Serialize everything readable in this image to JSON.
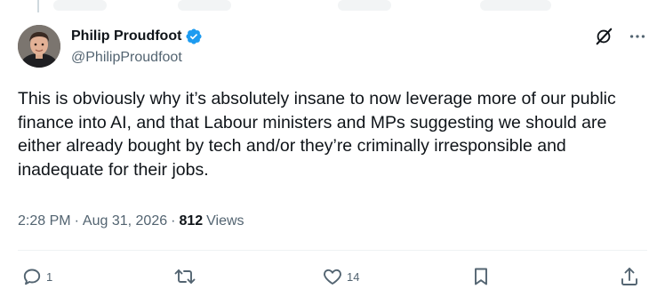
{
  "author": {
    "display_name": "Philip Proudfoot",
    "handle": "@PhilipProudfoot",
    "verified": true
  },
  "tweet": {
    "text": "This is obviously why it’s absolutely insane to now leverage more of our public finance into AI, and that Labour ministers and MPs suggesting we should are either already bought by tech and/or they’re criminally irresponsible and inadequate for their jobs.",
    "time": "2:28 PM",
    "date": "Aug 31, 2026",
    "views_count": "812",
    "views_label": "Views"
  },
  "engagement": {
    "replies": "1",
    "reposts": "",
    "likes": "14"
  },
  "colors": {
    "text_primary": "#0f1419",
    "text_secondary": "#536471",
    "verified_blue": "#1d9bf0",
    "divider": "#eff3f4"
  },
  "icons": [
    "verified-badge-icon",
    "grok-icon",
    "more-icon",
    "reply-icon",
    "repost-icon",
    "like-icon",
    "bookmark-icon",
    "share-icon"
  ]
}
